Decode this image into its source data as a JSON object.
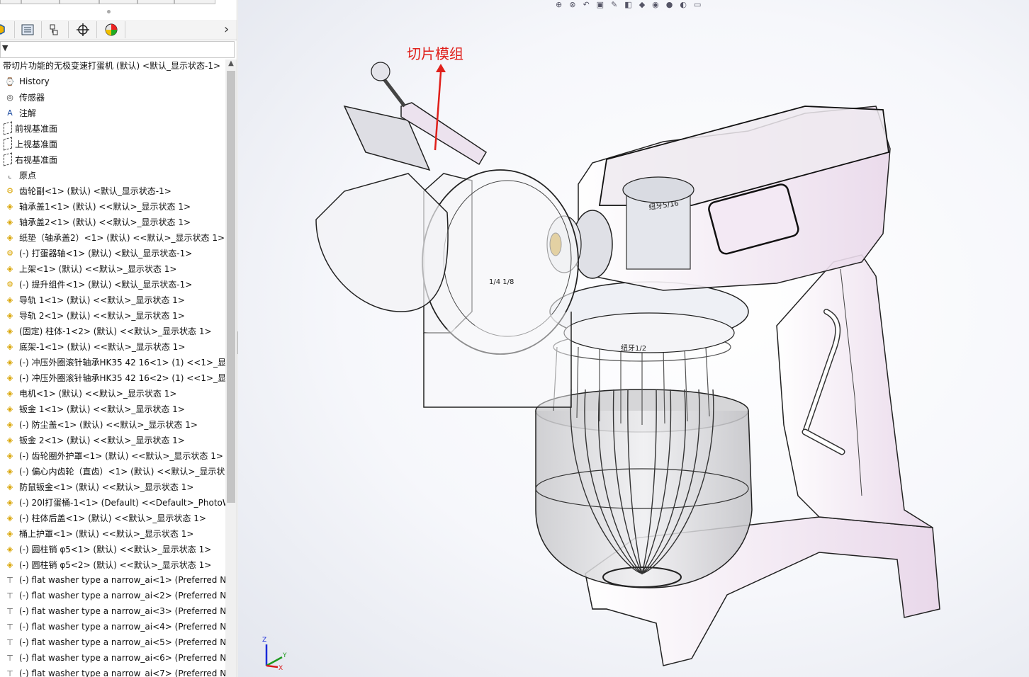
{
  "panel": {
    "collapse_glyph": "›",
    "tabs": [
      {
        "icon": "feature-manager-icon"
      },
      {
        "icon": "property-manager-icon"
      },
      {
        "icon": "configuration-manager-icon"
      },
      {
        "icon": "dimxpert-manager-icon"
      },
      {
        "icon": "display-manager-icon"
      }
    ],
    "filter_glyph": "▼",
    "root_label": "带切片功能的无极变速打蛋机 (默认) <默认_显示状态-1>",
    "tree": [
      {
        "icon": "history-icon",
        "label": "History"
      },
      {
        "icon": "sensor-icon",
        "label": "传感器"
      },
      {
        "icon": "annotation-icon",
        "label": "注解"
      },
      {
        "icon": "plane-icon",
        "label": "前视基准面"
      },
      {
        "icon": "plane-icon",
        "label": "上视基准面"
      },
      {
        "icon": "plane-icon",
        "label": "右视基准面"
      },
      {
        "icon": "origin-icon",
        "label": "原点"
      },
      {
        "icon": "assembly-icon",
        "label": "齿轮副<1> (默认) <默认_显示状态-1>"
      },
      {
        "icon": "part-icon",
        "label": "轴承盖1<1> (默认) <<默认>_显示状态 1>"
      },
      {
        "icon": "part-icon",
        "label": "轴承盖2<1> (默认) <<默认>_显示状态 1>"
      },
      {
        "icon": "part-icon",
        "label": "纸垫（轴承盖2）<1> (默认) <<默认>_显示状态 1>"
      },
      {
        "icon": "assembly-icon",
        "label": "(-) 打蛋器轴<1> (默认) <默认_显示状态-1>"
      },
      {
        "icon": "part-icon",
        "label": "上架<1> (默认) <<默认>_显示状态 1>"
      },
      {
        "icon": "assembly-icon",
        "label": "(-) 提升组件<1> (默认) <默认_显示状态-1>"
      },
      {
        "icon": "part-icon",
        "label": "导轨 1<1> (默认) <<默认>_显示状态 1>"
      },
      {
        "icon": "part-icon",
        "label": "导轨 2<1> (默认) <<默认>_显示状态 1>"
      },
      {
        "icon": "part-icon",
        "label": "(固定) 柱体-1<2> (默认) <<默认>_显示状态 1>"
      },
      {
        "icon": "part-icon",
        "label": "底架-1<1> (默认) <<默认>_显示状态 1>"
      },
      {
        "icon": "part-icon",
        "label": "(-) 冲压外圈滚针轴承HK35 42 16<1> (1) <<1>_显示"
      },
      {
        "icon": "part-icon",
        "label": "(-) 冲压外圈滚针轴承HK35 42 16<2> (1) <<1>_显示"
      },
      {
        "icon": "part-icon",
        "label": "电机<1> (默认) <<默认>_显示状态 1>"
      },
      {
        "icon": "part-icon",
        "label": "钣金 1<1> (默认) <<默认>_显示状态 1>"
      },
      {
        "icon": "part-icon",
        "label": "(-) 防尘盖<1> (默认) <<默认>_显示状态 1>"
      },
      {
        "icon": "part-icon",
        "label": "钣金 2<1> (默认) <<默认>_显示状态 1>"
      },
      {
        "icon": "part-icon",
        "label": "(-) 齿轮圈外护罩<1> (默认) <<默认>_显示状态 1>"
      },
      {
        "icon": "part-icon",
        "label": "(-) 偏心内齿轮（直齿）<1> (默认) <<默认>_显示状态"
      },
      {
        "icon": "part-icon",
        "label": "防鼠钣金<1> (默认) <<默认>_显示状态 1>"
      },
      {
        "icon": "part-icon",
        "label": "(-) 20l打蛋桶-1<1> (Default) <<Default>_PhotoWo"
      },
      {
        "icon": "part-icon",
        "label": "(-) 柱体后盖<1> (默认) <<默认>_显示状态 1>"
      },
      {
        "icon": "part-icon",
        "label": "桶上护罩<1> (默认) <<默认>_显示状态 1>"
      },
      {
        "icon": "part-icon",
        "label": "(-) 圆柱销 φ5<1> (默认) <<默认>_显示状态 1>"
      },
      {
        "icon": "part-icon",
        "label": "(-) 圆柱销 φ5<2> (默认) <<默认>_显示状态 1>"
      },
      {
        "icon": "toolbox-part-icon",
        "label": "(-) flat washer type a narrow_ai<1> (Preferred Na"
      },
      {
        "icon": "toolbox-part-icon",
        "label": "(-) flat washer type a narrow_ai<2> (Preferred Na"
      },
      {
        "icon": "toolbox-part-icon",
        "label": "(-) flat washer type a narrow_ai<3> (Preferred Na"
      },
      {
        "icon": "toolbox-part-icon",
        "label": "(-) flat washer type a narrow_ai<4> (Preferred Na"
      },
      {
        "icon": "toolbox-part-icon",
        "label": "(-) flat washer type a narrow_ai<5> (Preferred Na"
      },
      {
        "icon": "toolbox-part-icon",
        "label": "(-) flat washer type a narrow_ai<6> (Preferred Na"
      },
      {
        "icon": "toolbox-part-icon",
        "label": "(-) flat washer type a narrow_ai<7> (Preferred Na"
      }
    ]
  },
  "viewport": {
    "annotation_text": "切片模组",
    "annotation_color": "#e0201b",
    "model_labels": [
      "纽牙5/16",
      "1/4 1/8",
      "纽牙1/2"
    ],
    "triad": {
      "x": "X",
      "y": "Y",
      "z": "Z"
    },
    "toolbar_icons": [
      "zoom-to-fit-icon",
      "zoom-area-icon",
      "previous-view-icon",
      "section-view-icon",
      "dynamic-annotation-icon",
      "view-orientation-icon",
      "display-style-icon",
      "hide-show-icon",
      "edit-appearance-icon",
      "apply-scene-icon",
      "view-settings-icon"
    ]
  }
}
